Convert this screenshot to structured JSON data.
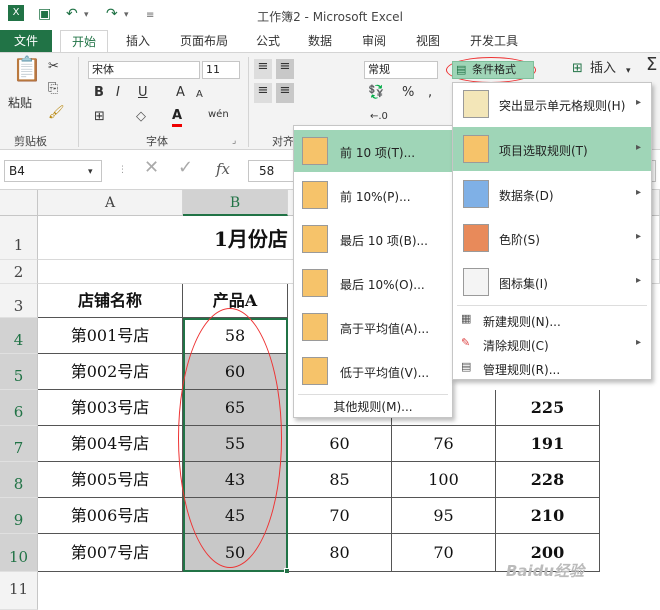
{
  "window": {
    "title": "工作簿2 - Microsoft Excel"
  },
  "ribbon_tabs": [
    "文件",
    "开始",
    "插入",
    "页面布局",
    "公式",
    "数据",
    "审阅",
    "视图",
    "开发工具"
  ],
  "ribbon": {
    "paste": "粘贴",
    "clipboard": "剪贴板",
    "font_group": "字体",
    "align_group": "对齐",
    "font_name": "宋体",
    "font_size": "11",
    "bold": "B",
    "italic": "I",
    "underline": "U",
    "font_color": "A",
    "wen": "wén",
    "number_format": "常规",
    "percent": "%",
    "comma": ",",
    "cond_format": "条件格式",
    "insert": "插入",
    "sigma": "Σ"
  },
  "formula_bar": {
    "name_box": "B4",
    "fx": "fx",
    "value": "58"
  },
  "columns": [
    "A",
    "B"
  ],
  "rows": [
    "1",
    "2",
    "3",
    "4",
    "5",
    "6",
    "7",
    "8",
    "9",
    "10",
    "11"
  ],
  "sheet": {
    "title": "1月份店",
    "header_a": "店铺名称",
    "header_b": "产品A",
    "stores": [
      "第001号店",
      "第002号店",
      "第003号店",
      "第004号店",
      "第005号店",
      "第006号店",
      "第007号店"
    ],
    "product_a": [
      "58",
      "60",
      "65",
      "55",
      "43",
      "45",
      "50"
    ],
    "col_c_visible": [
      "60",
      "85",
      "70",
      "80"
    ],
    "col_d_visible": [
      "76",
      "100",
      "95",
      "70"
    ],
    "totals_visible": [
      "225",
      "191",
      "228",
      "210",
      "200"
    ]
  },
  "top_bottom_menu": {
    "items": [
      "前 10 项(T)...",
      "前 10%(P)...",
      "最后 10 项(B)...",
      "最后 10%(O)...",
      "高于平均值(A)...",
      "低于平均值(V)..."
    ],
    "more": "其他规则(M)..."
  },
  "cond_menu": {
    "items": [
      "突出显示单元格规则(H)",
      "项目选取规则(T)",
      "数据条(D)",
      "色阶(S)",
      "图标集(I)"
    ],
    "extra": [
      "新建规则(N)...",
      "清除规则(C)",
      "管理规则(R)..."
    ]
  },
  "watermark": "Baidu经验"
}
